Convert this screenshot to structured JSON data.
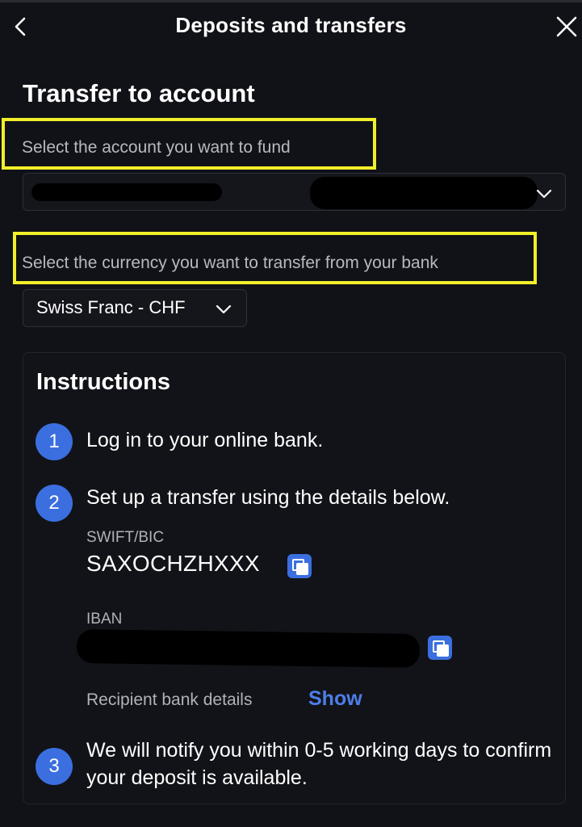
{
  "header": {
    "title": "Deposits and transfers"
  },
  "section": {
    "title": "Transfer to account"
  },
  "account": {
    "label": "Select the account you want to fund"
  },
  "currency": {
    "label": "Select the currency you want to transfer from your bank",
    "selected": "Swiss Franc - CHF"
  },
  "instructions": {
    "title": "Instructions",
    "steps": [
      {
        "number": "1",
        "text": "Log in to your online bank."
      },
      {
        "number": "2",
        "text": "Set up a transfer using the details below."
      },
      {
        "number": "3",
        "text": "We will notify you within 0-5 working days to confirm your deposit is available."
      }
    ],
    "swift_label": "SWIFT/BIC",
    "swift_value": "SAXOCHZHXXX",
    "iban_label": "IBAN",
    "recipient_label": "Recipient bank details",
    "show_label": "Show"
  },
  "icons": {
    "back": "chevron-left-icon",
    "close": "close-icon",
    "dropdown": "chevron-down-icon",
    "copy": "copy-icon"
  },
  "colors": {
    "background": "#111217",
    "accent": "#3b6fe0",
    "link": "#4d7ee8",
    "highlight": "#f2ef2a"
  }
}
